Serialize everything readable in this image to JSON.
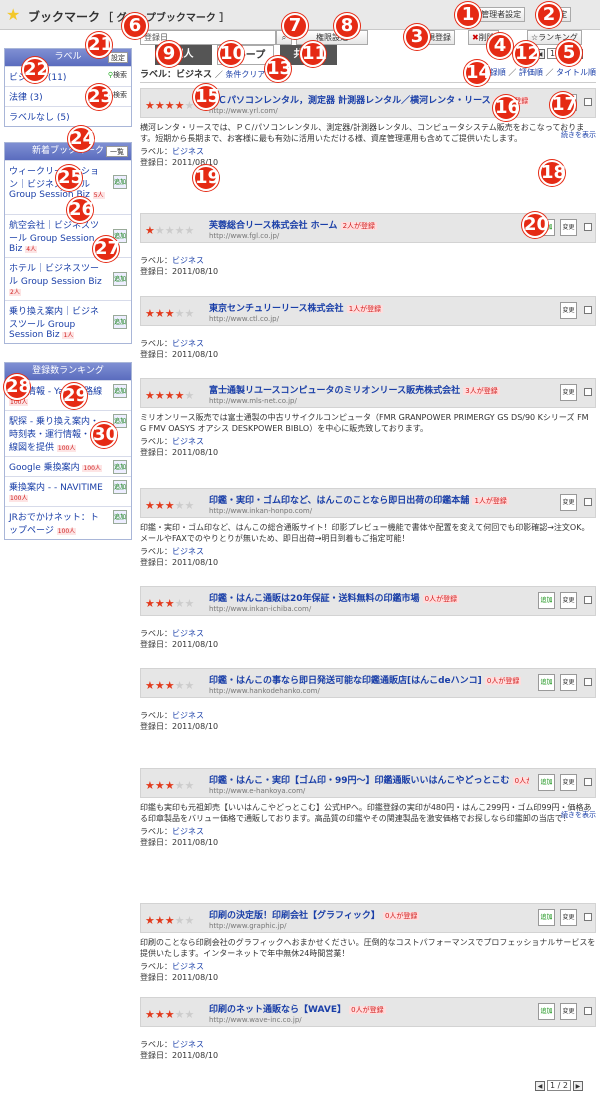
{
  "header": {
    "title": "ブックマーク",
    "subtitle": "［ グループブックマーク ］",
    "admin_label": "管理者設定",
    "settings_label": "設定"
  },
  "toolbar": {
    "register_label": "新規登録",
    "delete_label": "削除",
    "ranking_label": "ランキング",
    "search_placeholder": "登録日",
    "display_settings_label": "権限設定",
    "page": "1 / 2"
  },
  "tabs": [
    {
      "label": "個人"
    },
    {
      "label": "グループ"
    },
    {
      "label": "共　有"
    }
  ],
  "filter": {
    "label_prefix": "ラベル：ビジネス",
    "clear_label": "条件クリア",
    "sort_date": "登録順",
    "sort_rating": "評価順",
    "sort_title": "タイトル順"
  },
  "sidebar": {
    "labels_header": "ラベル",
    "labels_settings": "設定",
    "labels": [
      {
        "name": "ビジネス (11)",
        "search": "検索"
      },
      {
        "name": "法律 (3)",
        "search": "検索"
      },
      {
        "name": "ラベルなし (5)",
        "search": ""
      }
    ],
    "new_header": "新着ブックマーク",
    "new_list_label": "一覧",
    "new_items": [
      {
        "title": "ウィークリーマンション｜ビジネスツール Group Session Biz",
        "count": "5人"
      },
      {
        "title": "航空会社｜ビジネスツール Group Session Biz",
        "count": "4人"
      },
      {
        "title": "ホテル｜ビジネスツール Group Session Biz",
        "count": "2人"
      },
      {
        "title": "乗り換え案内｜ビジネスツール Group Session Biz",
        "count": "1人"
      }
    ],
    "ranking_header": "登録数ランキング",
    "ranking": [
      {
        "title": "路線情報 - Yahoo!路線",
        "count": "100人"
      },
      {
        "title": "駅探 - 乗り換え案内・時刻表・運行情報・路線図を提供",
        "count": "100人"
      },
      {
        "title": "Google 乗換案内",
        "count": "100人"
      },
      {
        "title": "乗換案内 - - NAVITIME",
        "count": "100人"
      },
      {
        "title": "JRおでかけネット：トップページ",
        "count": "100人"
      }
    ],
    "add_label": "追加"
  },
  "entries": [
    {
      "stars": 4,
      "title": "ＰＣパソコンレンタル，測定器 計測器レンタル／横河レンタ・リース",
      "count": "1人が登録",
      "url": "http://www.yrl.com/",
      "desc": "横河レンタ・リースでは、ＰＣ/パソコンレンタル、測定器/計測器レンタル、コンピュータシステム販売をおこなっております。短期から長期まで、お客様に最も有効に活用いただける様、資産管理運用も含めてご提供いたします。",
      "label": "ビジネス",
      "date": "登録日：2011/08/10",
      "more": "続きを表示"
    },
    {
      "stars": 1,
      "title": "芙蓉総合リース株式会社 ホーム",
      "count": "2人が登録",
      "url": "http://www.fgl.co.jp/",
      "desc": "",
      "label": "ビジネス",
      "date": "登録日：2011/08/10",
      "more": ""
    },
    {
      "stars": 3,
      "title": "東京センチュリーリース株式会社",
      "count": "1人が登録",
      "url": "http://www.ctl.co.jp/",
      "desc": "",
      "label": "ビジネス",
      "date": "登録日：2011/08/10",
      "more": ""
    },
    {
      "stars": 4,
      "title": "富士通製リユースコンピュータのミリオンリース販売株式会社",
      "count": "3人が登録",
      "url": "http://www.mls-net.co.jp/",
      "desc": "ミリオンリース販売では富士通製の中古リサイクルコンピュータ（FMR GRANPOWER PRIMERGY GS DS/90 Kシリーズ FM G FMV OASYS オアシス DESKPOWER BIBLO）を中心に販売致しております。",
      "label": "ビジネス",
      "date": "登録日：2011/08/10",
      "more": ""
    },
    {
      "stars": 3,
      "title": "印鑑・実印・ゴム印など、はんこのことなら即日出荷の印鑑本舗",
      "count": "1人が登録",
      "url": "http://www.inkan-honpo.com/",
      "desc": "印鑑・実印・ゴム印など、はんこの総合通販サイト！印影プレビュー機能で書体や配置を変えて何回でも印影確認→注文OK。メールやFAXでのやりとりが無いため、即日出荷→明日到着もご指定可能！",
      "label": "ビジネス",
      "date": "登録日：2011/08/10",
      "more": ""
    },
    {
      "stars": 3,
      "title": "印鑑・はんこ通販は20年保証・送料無料の印鑑市場",
      "count": "0人が登録",
      "url": "http://www.inkan-ichiba.com/",
      "desc": "",
      "label": "ビジネス",
      "date": "登録日：2011/08/10",
      "more": ""
    },
    {
      "stars": 3,
      "title": "印鑑・はんこの事なら即日発送可能な印鑑通販店[はんこdeハンコ]",
      "count": "0人が登録",
      "url": "http://www.hankodehanko.com/",
      "desc": "",
      "label": "ビジネス",
      "date": "登録日：2011/08/10",
      "more": ""
    },
    {
      "stars": 3,
      "title": "印鑑・はんこ・実印【ゴム印・99円～】印鑑通販いいはんこやどっとこむ",
      "count": "0人が登録",
      "url": "http://www.e-hankoya.com/",
      "desc": "印鑑も実印も元祖卸売【いいはんこやどっとこむ】公式HPへ。印鑑登録の実印が480円・はんこ299円・ゴム印99円・価格ある印章製品をバリュー価格で通販しております。高品質の印鑑やその関連製品を激安価格でお探しなら印鑑卸の当店で！",
      "label": "ビジネス",
      "date": "登録日：2011/08/10",
      "more": "続きを表示"
    },
    {
      "stars": 3,
      "title": "印刷の決定版！印刷会社【グラフィック】",
      "count": "0人が登録",
      "url": "http://www.graphic.jp/",
      "desc": "印刷のことなら印刷会社のグラフィックへおまかせください。圧倒的なコストパフォーマンスでプロフェッショナルサービスを提供いたします。インターネットで年中無休24時間営業！",
      "label": "ビジネス",
      "date": "登録日：2011/08/10",
      "more": ""
    },
    {
      "stars": 3,
      "title": "印刷のネット通販なら【WAVE】",
      "count": "0人が登録",
      "url": "http://www.wave-inc.co.jp/",
      "desc": "",
      "label": "ビジネス",
      "date": "登録日：2011/08/10",
      "more": ""
    }
  ],
  "labels": {
    "label_prefix": "ラベル：",
    "add": "追加",
    "edit": "変更"
  },
  "markers": [
    "1",
    "2",
    "3",
    "4",
    "5",
    "6",
    "7",
    "8",
    "9",
    "10",
    "11",
    "12",
    "13",
    "14",
    "15",
    "16",
    "17",
    "18",
    "19",
    "20",
    "21",
    "22",
    "23",
    "24",
    "25",
    "26",
    "27",
    "28",
    "29",
    "30"
  ],
  "colors": {
    "accent": "#e23a1d",
    "link": "#1a3fa8",
    "side_header": "#6677c8"
  }
}
